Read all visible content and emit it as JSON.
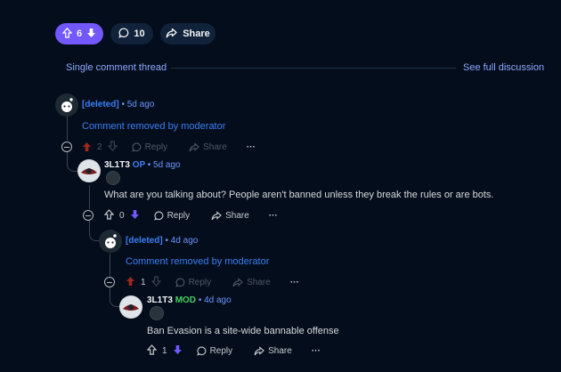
{
  "post_actions": {
    "vote_count": "6",
    "comment_count": "10",
    "share_label": "Share"
  },
  "thread": {
    "title": "Single comment thread",
    "see_full": "See full discussion"
  },
  "comments": [
    {
      "author": "[deleted]",
      "time": "• 5d ago",
      "body": "Comment removed by moderator",
      "votes": "2",
      "reply_label": "Reply",
      "share_label": "Share",
      "more": "···"
    },
    {
      "author": "3L1T3",
      "flair": "OP",
      "time": "• 5d ago",
      "body": "What are you talking about? People aren't banned unless they break the rules or are bots.",
      "votes": "0",
      "reply_label": "Reply",
      "share_label": "Share",
      "more": "···"
    },
    {
      "author": "[deleted]",
      "time": "• 4d ago",
      "body": "Comment removed by moderator",
      "votes": "1",
      "reply_label": "Reply",
      "share_label": "Share",
      "more": "···"
    },
    {
      "author": "3L1T3",
      "flair": "MOD",
      "time": "• 4d ago",
      "body": "Ban Evasion is a site-wide bannable offense",
      "votes": "1",
      "reply_label": "Reply",
      "share_label": "Share",
      "more": "···"
    }
  ],
  "colors": {
    "background": "#030d1b",
    "accent": "#7357ff",
    "link": "#3d7ff5",
    "mod": "#46d160",
    "downvoted": "#d93a00"
  }
}
